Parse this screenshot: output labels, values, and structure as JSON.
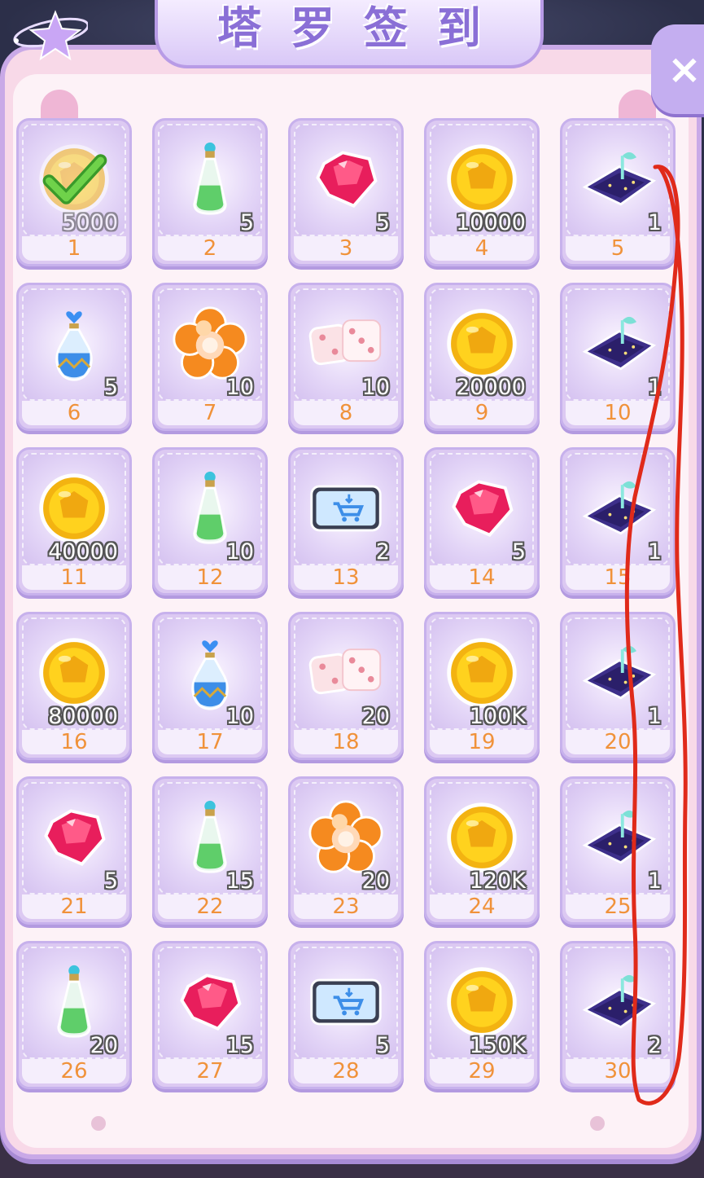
{
  "title": "塔罗签到",
  "colors": {
    "day_number": "#f0923a",
    "panel": "#fdf2f7",
    "cell": "#dcc9f2",
    "annotation": "#e02a1a"
  },
  "close_icon": "close-icon",
  "days": [
    {
      "day": "1",
      "qty": "5000",
      "icon": "coin-icon",
      "claimed": true
    },
    {
      "day": "2",
      "qty": "5",
      "icon": "green-potion-icon"
    },
    {
      "day": "3",
      "qty": "5",
      "icon": "ruby-icon"
    },
    {
      "day": "4",
      "qty": "10000",
      "icon": "coin-icon"
    },
    {
      "day": "5",
      "qty": "1",
      "icon": "tarot-card-icon"
    },
    {
      "day": "6",
      "qty": "5",
      "icon": "blue-potion-icon"
    },
    {
      "day": "7",
      "qty": "10",
      "icon": "flower-icon"
    },
    {
      "day": "8",
      "qty": "10",
      "icon": "dice-icon"
    },
    {
      "day": "9",
      "qty": "20000",
      "icon": "coin-icon"
    },
    {
      "day": "10",
      "qty": "1",
      "icon": "tarot-card-icon"
    },
    {
      "day": "11",
      "qty": "40000",
      "icon": "coin-icon"
    },
    {
      "day": "12",
      "qty": "10",
      "icon": "green-potion-icon"
    },
    {
      "day": "13",
      "qty": "2",
      "icon": "cart-ticket-icon"
    },
    {
      "day": "14",
      "qty": "5",
      "icon": "ruby-icon"
    },
    {
      "day": "15",
      "qty": "1",
      "icon": "tarot-card-icon"
    },
    {
      "day": "16",
      "qty": "80000",
      "icon": "coin-icon"
    },
    {
      "day": "17",
      "qty": "10",
      "icon": "blue-potion-icon"
    },
    {
      "day": "18",
      "qty": "20",
      "icon": "dice-icon"
    },
    {
      "day": "19",
      "qty": "100K",
      "icon": "coin-icon"
    },
    {
      "day": "20",
      "qty": "1",
      "icon": "tarot-card-icon"
    },
    {
      "day": "21",
      "qty": "5",
      "icon": "ruby-icon"
    },
    {
      "day": "22",
      "qty": "15",
      "icon": "green-potion-icon"
    },
    {
      "day": "23",
      "qty": "20",
      "icon": "flower-icon"
    },
    {
      "day": "24",
      "qty": "120K",
      "icon": "coin-icon"
    },
    {
      "day": "25",
      "qty": "1",
      "icon": "tarot-card-icon"
    },
    {
      "day": "26",
      "qty": "20",
      "icon": "green-potion-icon"
    },
    {
      "day": "27",
      "qty": "15",
      "icon": "ruby-icon"
    },
    {
      "day": "28",
      "qty": "5",
      "icon": "cart-ticket-icon"
    },
    {
      "day": "29",
      "qty": "150K",
      "icon": "coin-icon"
    },
    {
      "day": "30",
      "qty": "2",
      "icon": "tarot-card-icon"
    }
  ]
}
